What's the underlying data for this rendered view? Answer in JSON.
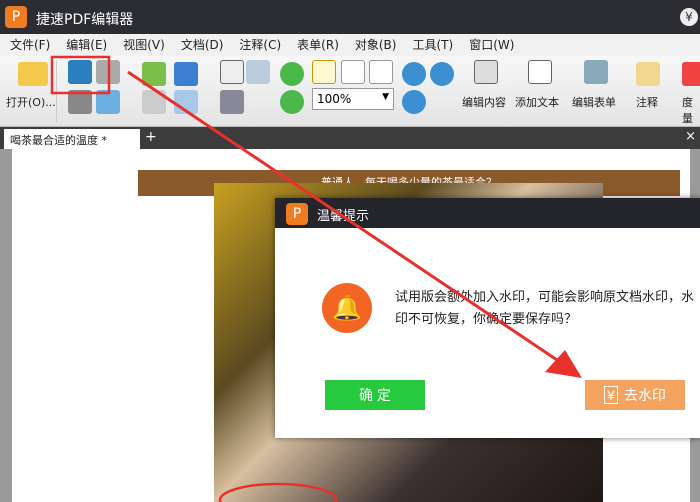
{
  "app": {
    "title": "捷速PDF编辑器",
    "logo": "P"
  },
  "menu": [
    "文件(F)",
    "编辑(E)",
    "视图(V)",
    "文档(D)",
    "注释(C)",
    "表单(R)",
    "对象(B)",
    "工具(T)",
    "窗口(W)"
  ],
  "toolbar": {
    "open": "打开(O)...",
    "zoom": "100%",
    "edit_content": "编辑内容",
    "add_text": "添加文本",
    "edit_form": "编辑表单",
    "annotate": "注释",
    "measure": "度量"
  },
  "tabs": {
    "active": "喝茶最合适的温度 *",
    "add": "+",
    "close": "×"
  },
  "document": {
    "banner": "普通人，每天喝多少量的茶最适合？"
  },
  "dialog": {
    "title": "温馨提示",
    "message": "试用版会额外加入水印，可能会影响原文档水印，水印不可恢复，你确定要保存吗？",
    "confirm": "确 定",
    "remove_watermark": "去水印"
  },
  "colors": {
    "brand": "#f07c22",
    "confirm": "#27c93f",
    "remove": "#f4a460",
    "annotation": "#e8302c"
  }
}
